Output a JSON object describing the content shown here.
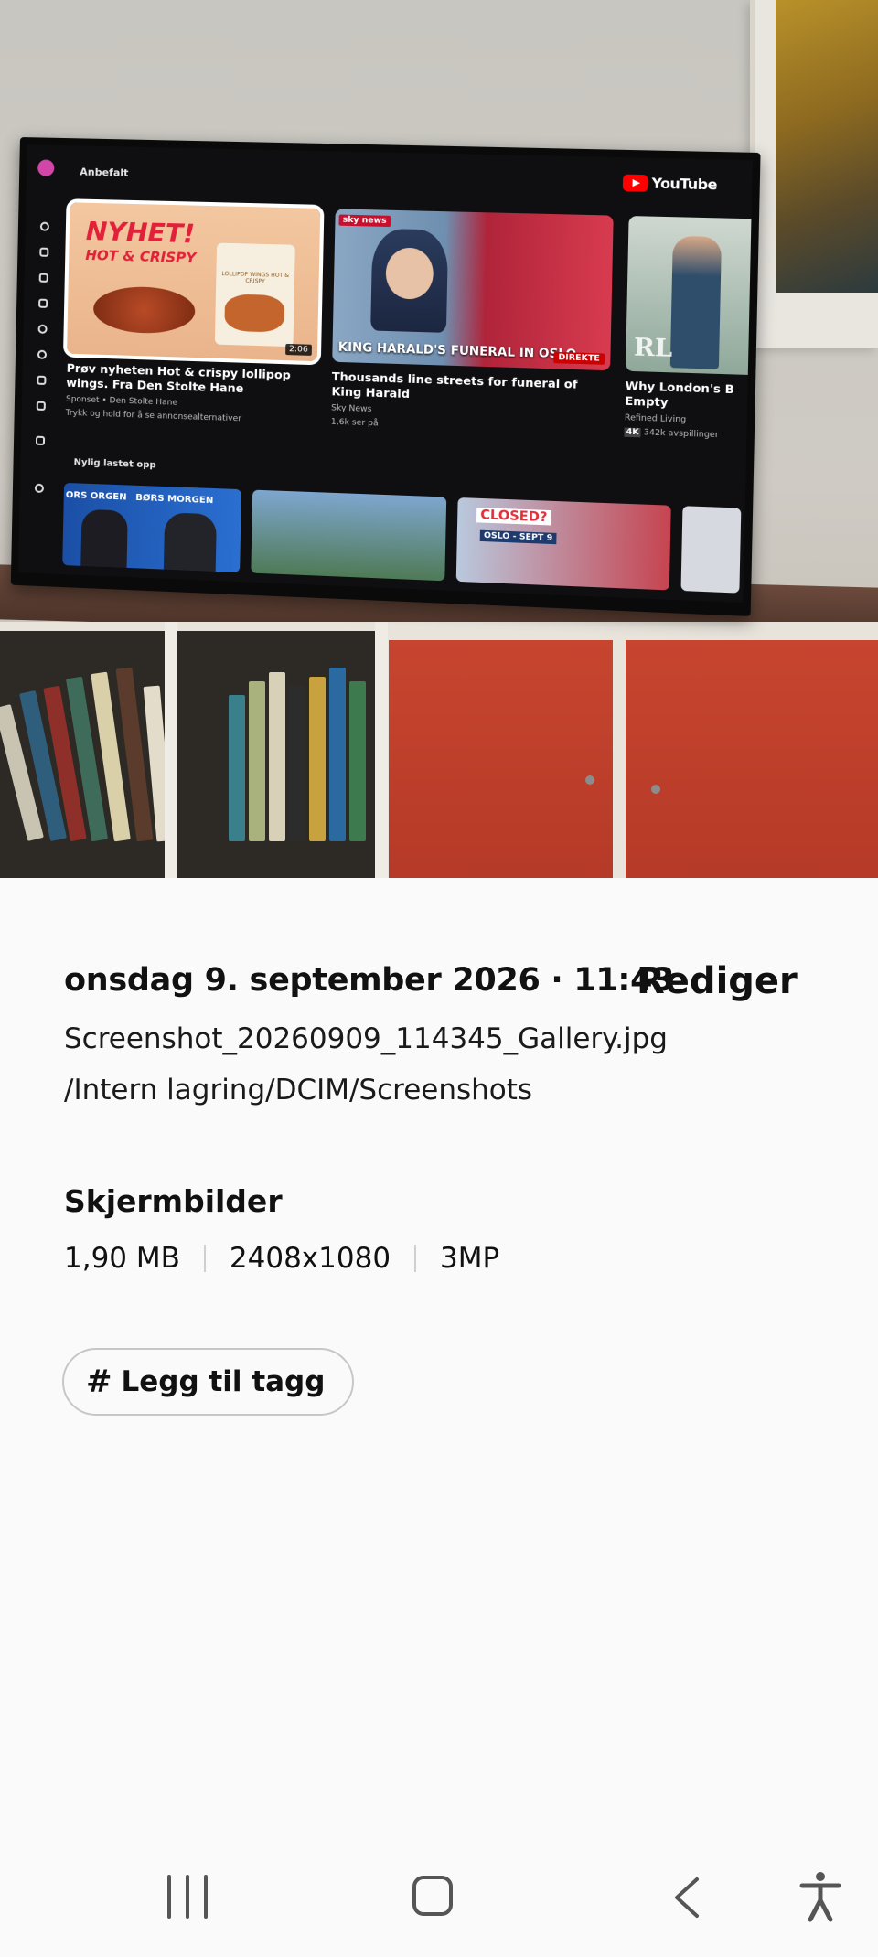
{
  "photo": {
    "tv_screen": {
      "section_recommended": "Anbefalt",
      "brand": "YouTube",
      "cards": [
        {
          "title": "Prøv nyheten Hot & crispy lollipop wings. Fra Den Stolte Hane",
          "meta_1": "Sponset • Den Stolte Hane",
          "meta_2": "Trykk og hold for å se annonsealternativer",
          "duration": "2:06",
          "thumb_text_1": "NYHET!",
          "thumb_text_2": "HOT & CRISPY",
          "thumb_text_3": "LOLLIPOP WINGS HOT & CRISPY"
        },
        {
          "title": "Thousands line streets for funeral of King Harald",
          "meta_1": "Sky News",
          "meta_2": "1,6k ser på",
          "badge": "DIREKTE",
          "thumb_text_1": "sky news",
          "thumb_text_2": "KING HARALD'S FUNERAL IN OSLO"
        },
        {
          "title": "Why London's B Empty",
          "meta_1": "Refined Living",
          "meta_2": "342k avspillinger",
          "quality": "4K",
          "thumb_text_1": "RL"
        }
      ],
      "section_recent": "Nylig lastet opp",
      "row2_texts": [
        "ORS ORGEN",
        "BØRS MORGEN",
        "CLOSED?",
        "OSLO - SEPT 9"
      ]
    }
  },
  "info": {
    "datetime": "onsdag 9. september 2026 · 11:43",
    "edit_label": "Rediger",
    "filename": "Screenshot_20260909_114345_Gallery.jpg",
    "path": "/Intern lagring/DCIM/Screenshots",
    "album": "Skjermbilder",
    "size": "1,90 MB",
    "resolution": "2408x1080",
    "megapixels": "3MP",
    "tag_symbol": "#",
    "tag_label": "Legg til tagg"
  },
  "navbar": {
    "recents_icon": "recents-icon",
    "home_icon": "home-icon",
    "back_icon": "back-icon",
    "accessibility_icon": "accessibility-icon"
  }
}
